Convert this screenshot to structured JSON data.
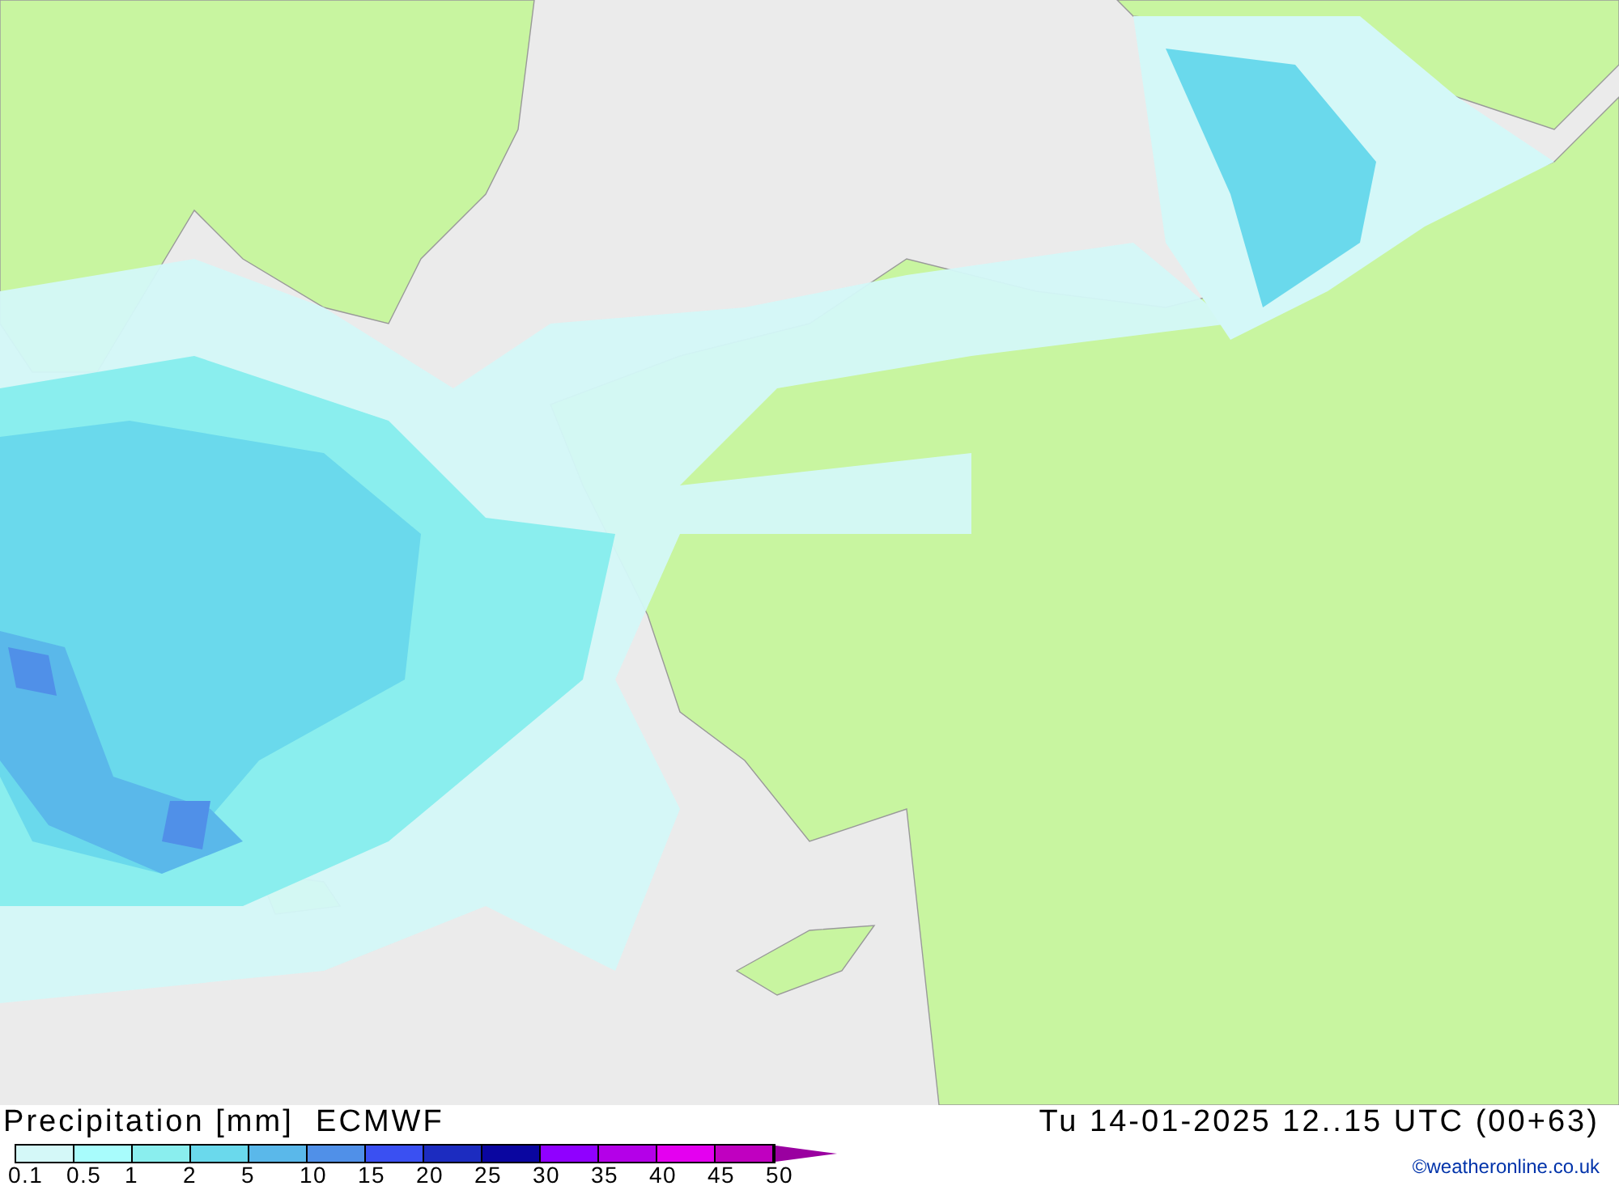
{
  "title": "Precipitation [mm]  ECMWF",
  "valid_time": "Tu 14-01-2025 12..15 UTC (00+63)",
  "legend": {
    "segments": [
      {
        "color": "#d4f8f8"
      },
      {
        "color": "#a8fcfc"
      },
      {
        "color": "#8aeeee"
      },
      {
        "color": "#6ad9ec"
      },
      {
        "color": "#5ab8ea"
      },
      {
        "color": "#5090e8"
      },
      {
        "color": "#3a50f2"
      },
      {
        "color": "#1c2cc0"
      },
      {
        "color": "#0a06a0"
      },
      {
        "color": "#9000ff"
      },
      {
        "color": "#b400e8"
      },
      {
        "color": "#e400f0"
      },
      {
        "color": "#c000c0"
      }
    ],
    "tail": {
      "color": "#9a00a0"
    },
    "ticks": [
      "0.1",
      "0.5",
      "1",
      "2",
      "5",
      "10",
      "15",
      "20",
      "25",
      "30",
      "35",
      "40",
      "45",
      "50"
    ]
  },
  "credit": "©weatheronline.co.uk"
}
